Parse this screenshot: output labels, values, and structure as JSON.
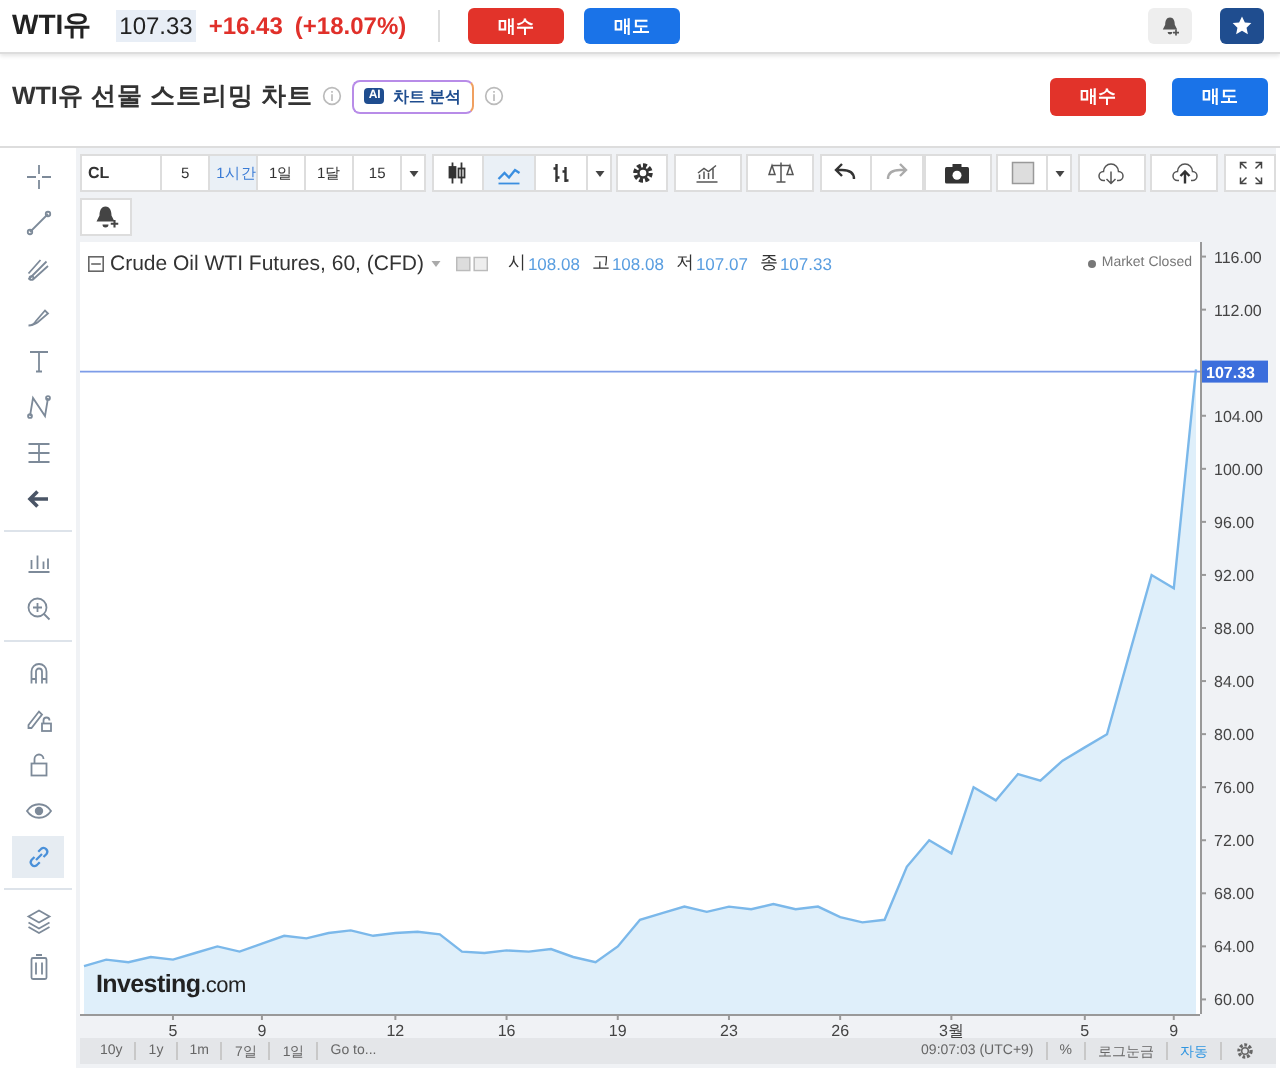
{
  "header": {
    "symbol": "WTI유",
    "price": "107.33",
    "change": "+16.43",
    "change_pct": "(+18.07%)",
    "buttons": [
      {
        "kind": "buy",
        "label": "매수"
      },
      {
        "kind": "sell",
        "label": "매도"
      }
    ]
  },
  "title_row": {
    "title": "WTI유 선물 스트리밍 차트",
    "ai_badge": {
      "icon": "AI",
      "label": "차트 분석"
    },
    "buttons": [
      {
        "kind": "buy",
        "label": "매수"
      },
      {
        "kind": "sell",
        "label": "매도"
      }
    ]
  },
  "chart_toolbar": {
    "symbol": "CL",
    "intervals": [
      {
        "label": "5",
        "selected": false
      },
      {
        "label": "1시간",
        "selected": true
      },
      {
        "label": "1일",
        "selected": false
      },
      {
        "label": "1달",
        "selected": false
      },
      {
        "label": "15",
        "selected": false
      }
    ],
    "chart_types": [
      {
        "kind": "candles",
        "selected": false
      },
      {
        "kind": "line",
        "selected": true
      },
      {
        "kind": "bars",
        "selected": false
      }
    ]
  },
  "drawing_tools": [
    [
      {
        "kind": "crosshair",
        "selected": false
      },
      {
        "kind": "trend-line",
        "selected": false
      },
      {
        "kind": "pitchfork",
        "selected": false
      },
      {
        "kind": "brush",
        "selected": false
      },
      {
        "kind": "text",
        "selected": false
      },
      {
        "kind": "pattern",
        "selected": false
      },
      {
        "kind": "measure",
        "selected": false
      },
      {
        "kind": "back",
        "selected": false
      }
    ],
    [
      {
        "kind": "indicators",
        "selected": false
      },
      {
        "kind": "zoom",
        "selected": false
      }
    ],
    [
      {
        "kind": "magnet",
        "selected": false
      },
      {
        "kind": "lock-drawing",
        "selected": false
      },
      {
        "kind": "lock",
        "selected": false
      },
      {
        "kind": "eye",
        "selected": false
      },
      {
        "kind": "link",
        "selected": true
      }
    ],
    [
      {
        "kind": "layers",
        "selected": false
      },
      {
        "kind": "trash",
        "selected": false
      }
    ]
  ],
  "legend": {
    "title": "Crude Oil WTI Futures, 60, (CFD)",
    "ohlc": [
      {
        "label": "시",
        "value": "108.08"
      },
      {
        "label": "고",
        "value": "108.08"
      },
      {
        "label": "저",
        "value": "107.07"
      },
      {
        "label": "종",
        "value": "107.33"
      }
    ],
    "status": "Market Closed"
  },
  "chart_data": {
    "type": "area",
    "categories": [
      null,
      null,
      null,
      null,
      "5",
      null,
      null,
      null,
      "9",
      null,
      null,
      null,
      null,
      null,
      "12",
      null,
      null,
      null,
      null,
      "16",
      null,
      null,
      null,
      null,
      "19",
      null,
      null,
      null,
      null,
      "23",
      null,
      null,
      null,
      null,
      "26",
      null,
      null,
      null,
      null,
      "3월",
      null,
      null,
      null,
      null,
      null,
      "5",
      null,
      null,
      null,
      "9",
      null
    ],
    "series": [
      {
        "color": "#7bb8ea",
        "values": [
          62.5,
          63,
          62.8,
          63.2,
          63,
          63.5,
          64,
          63.6,
          64.2,
          64.8,
          64.6,
          65,
          65.2,
          64.8,
          65,
          65.1,
          64.9,
          63.6,
          63.5,
          63.7,
          63.6,
          63.8,
          63.2,
          62.8,
          64,
          66,
          66.5,
          67,
          66.6,
          67,
          66.8,
          67.2,
          66.8,
          67,
          66.2,
          65.8,
          66,
          70,
          72,
          71,
          76,
          75,
          77,
          76.5,
          78,
          79,
          80,
          86,
          92,
          91,
          107.5
        ]
      }
    ],
    "ylim": [
      58.9,
      117.1
    ],
    "yticks": [
      {
        "value": 116,
        "label": "116.00"
      },
      {
        "value": 112,
        "label": "112.00"
      },
      {
        "value": 104,
        "label": "104.00"
      },
      {
        "value": 100,
        "label": "100.00"
      },
      {
        "value": 96,
        "label": "96.00"
      },
      {
        "value": 92,
        "label": "92.00"
      },
      {
        "value": 88,
        "label": "88.00"
      },
      {
        "value": 84,
        "label": "84.00"
      },
      {
        "value": 80,
        "label": "80.00"
      },
      {
        "value": 76,
        "label": "76.00"
      },
      {
        "value": 72,
        "label": "72.00"
      },
      {
        "value": 68,
        "label": "68.00"
      },
      {
        "value": 64,
        "label": "64.00"
      },
      {
        "value": 60,
        "label": "60.00"
      }
    ],
    "ref_lines": [
      {
        "axis": "y",
        "value": 107.33,
        "label": "107.33"
      }
    ]
  },
  "logo": {
    "name": "Investing",
    "suffix": ".com"
  },
  "bottom_bar": {
    "ranges": [
      "10y",
      "1y",
      "1m",
      "7일",
      "1일",
      "Go to..."
    ],
    "time": "09:07:03 (UTC+9)",
    "options": [
      {
        "label": "%",
        "selected": false
      },
      {
        "label": "로그눈금",
        "selected": false
      },
      {
        "label": "자동",
        "selected": true
      }
    ]
  }
}
